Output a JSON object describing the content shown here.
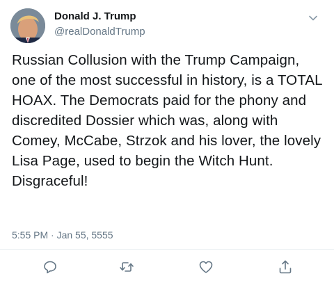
{
  "tweet": {
    "author_name": "Donald J. Trump",
    "author_handle": "@realDonaldTrump",
    "body": "Russian Collusion with the Trump Campaign, one of the most successful in history, is a TOTAL HOAX. The Democrats paid for the phony and discredited Dossier which was, along with Comey, McCabe, Strzok and his lover, the lovely Lisa Page, used to begin the Witch Hunt. Disgraceful!",
    "timestamp": "5:55 PM · Jan 55, 5555"
  },
  "icons": {
    "menu": "chevron-down-icon",
    "reply": "reply-icon",
    "retweet": "retweet-icon",
    "like": "heart-icon",
    "share": "share-icon"
  },
  "colors": {
    "text": "#14171a",
    "secondary": "#657786",
    "divider": "#e6ecf0"
  }
}
